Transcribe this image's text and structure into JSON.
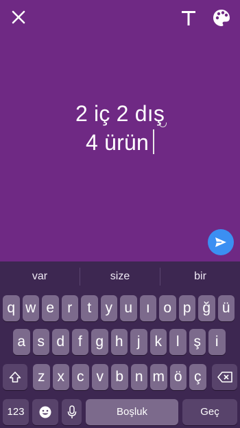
{
  "story": {
    "line1": "2 iç 2 dış",
    "line2": "4 ürün"
  },
  "icons": {
    "close": "close-icon",
    "text": "text-format-icon",
    "palette": "palette-icon",
    "send": "send-icon"
  },
  "colors": {
    "background": "#6f2984",
    "keyboard": "#3d2751",
    "send_button": "#3b8ff2"
  },
  "suggestions": [
    "var",
    "size",
    "bir"
  ],
  "keyboard": {
    "row1": [
      "q",
      "w",
      "e",
      "r",
      "t",
      "y",
      "u",
      "ı",
      "o",
      "p",
      "ğ",
      "ü"
    ],
    "row2": [
      "a",
      "s",
      "d",
      "f",
      "g",
      "h",
      "j",
      "k",
      "l",
      "ş",
      "i"
    ],
    "row3": [
      "z",
      "x",
      "c",
      "v",
      "b",
      "n",
      "m",
      "ö",
      "ç"
    ],
    "numbers_label": "123",
    "space_label": "Boşluk",
    "return_label": "Geç"
  }
}
